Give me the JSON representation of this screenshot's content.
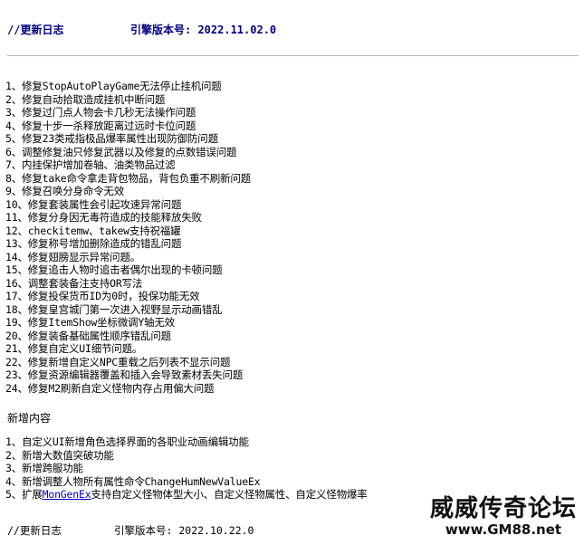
{
  "header": {
    "title": "//更新日志",
    "engine": "引擎版本号: 2022.11.02.0"
  },
  "fixes": [
    "1、修复StopAutoPlayGame无法停止挂机问题",
    "2、修复自动拾取造成挂机中断问题",
    "3、修复过门点人物会卡几秒无法操作问题",
    "4、修复十步一杀释放距离过远时卡位问题",
    "5、修复23类戒指极品爆率属性出现防御防问题",
    "6、调整修复油只修复武器以及修复的点数错误问题",
    "7、内挂保护增加卷轴、油类物品过滤",
    "8、修复take命令拿走背包物品，背包负重不刷新问题",
    "9、修复召唤分身命令无效",
    "10、修复套装属性会引起攻速异常问题",
    "11、修复分身因无毒符造成的技能释放失败",
    "12、checkitemw、takew支持祝福罐",
    "13、修复称号增加删除造成的错乱问题",
    "14、修复翅膀显示异常问题。",
    "15、修复追击人物时追击者偶尔出现的卡顿问题",
    "16、调整套装备注支持OR写法",
    "17、修复投保货币ID为0时，投保功能无效",
    "18、修复皇宫城门第一次进入视野显示动画错乱",
    "19、修复ItemShow坐标微调Y轴无效",
    "20、修复装备基础属性顺序错乱问题",
    "21、修复自定义UI细节问题。",
    "22、修复新增自定义NPC重载之后列表不显示问题",
    "23、修复资源编辑器覆盖和插入会导致素材丢失问题",
    "24、修复M2刷新自定义怪物内存占用偏大问题"
  ],
  "new_section_title": "新增内容",
  "additions": [
    {
      "text": "1、自定义UI新增角色选择界面的各职业动画编辑功能"
    },
    {
      "text": "2、新增大数值突破功能"
    },
    {
      "text": "3、新增跨服功能"
    },
    {
      "text": "4、新增调整人物所有属性命令ChangeHumNewValueEx"
    },
    {
      "prefix": "5、扩展",
      "link": "MonGenEx",
      "suffix": "支持自定义怪物体型大小、自定义怪物属性、自定义怪物爆率"
    }
  ],
  "footer": {
    "title": "//更新日志",
    "engine": "引擎版本号: 2022.10.22.0"
  },
  "watermark": {
    "title": "威威传奇论坛",
    "url": "www.GM88.net"
  }
}
